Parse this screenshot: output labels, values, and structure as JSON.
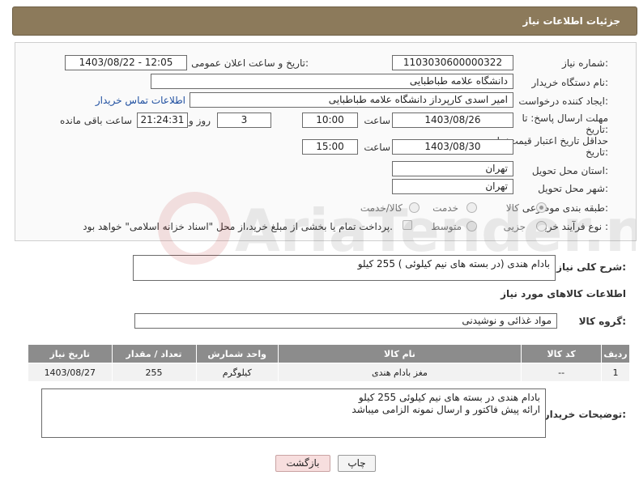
{
  "header": {
    "title": "جزئیات اطلاعات نیاز"
  },
  "form": {
    "need_number_label": "شماره نیاز:",
    "need_number": "1103030600000322",
    "announce_label": "تاریخ و ساعت اعلان عمومی:",
    "announce_value": "1403/08/22 - 12:05",
    "buyer_org_label": "نام دستگاه خریدار:",
    "buyer_org": "دانشگاه علامه طباطبایی",
    "creator_label": "ایجاد کننده درخواست:",
    "creator": "امیر اسدی کارپرداز دانشگاه علامه طباطبایی",
    "contact_link": "اطلاعات تماس خریدار",
    "deadline_label_1": "مهلت ارسال پاسخ: تا",
    "deadline_label_2": "تاریخ:",
    "deadline_date": "1403/08/26",
    "time_label": "ساعت",
    "deadline_time": "10:00",
    "days_value": "3",
    "days_label": "روز و",
    "remaining_time": "21:24:31",
    "remaining_label": "ساعت باقی مانده",
    "min_validity_label_1": "حداقل تاریخ اعتبار قیمت: تا",
    "min_validity_label_2": "تاریخ:",
    "validity_date": "1403/08/30",
    "validity_time": "15:00",
    "province_label": "استان محل تحویل:",
    "province": "تهران",
    "city_label": "شهر محل تحویل:",
    "city": "تهران",
    "category_label": "طبقه بندی موضوعی:",
    "category_options": [
      "کالا",
      "خدمت",
      "کالا/خدمت"
    ],
    "process_label": "نوع فرآیند خرید :",
    "process_options": [
      "جزیی",
      "متوسط"
    ],
    "payment_note": "پرداخت تمام یا بخشی از مبلغ خرید،از محل \"اسناد خزانه اسلامی\" خواهد بود."
  },
  "summary": {
    "label": "شرح کلی نیاز:",
    "value": "بادام هندی (در بسته های نیم کیلوئی )  255 کیلو"
  },
  "goods_section": {
    "title": "اطلاعات کالاهای مورد نیاز",
    "group_label": "گروه کالا:",
    "group_value": "مواد غذائی و نوشیدنی"
  },
  "table": {
    "headers": [
      "ردیف",
      "کد کالا",
      "نام کالا",
      "واحد شمارش",
      "تعداد / مقدار",
      "تاریخ نیاز"
    ],
    "rows": [
      [
        "1",
        "--",
        "مغز بادام هندی",
        "کیلوگرم",
        "255",
        "1403/08/27"
      ]
    ]
  },
  "buyer_notes": {
    "label": "توضیحات خریدار:",
    "line1": "بادام هندی در بسته های نیم کیلوئی    255 کیلو",
    "line2": "ارائه پیش فاکتور و  ارسال نمونه الزامی میباشد"
  },
  "buttons": {
    "print": "چاپ",
    "back": "بازگشت"
  },
  "watermark": {
    "text": "AriaTender.net"
  },
  "colors": {
    "header_bg": "#8c7a5b",
    "table_header_bg": "#8c8c8c",
    "back_button_bg": "#f7dede",
    "link": "#1f4fa0"
  }
}
